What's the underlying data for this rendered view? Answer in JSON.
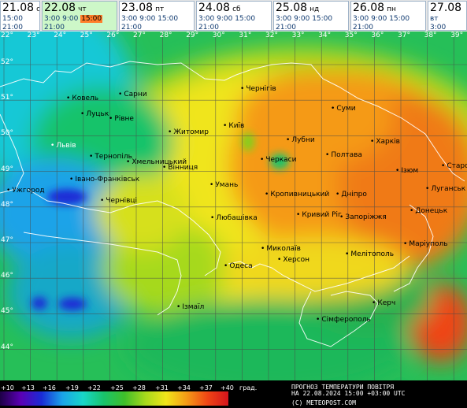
{
  "days": [
    {
      "date": "21.08",
      "dow": "ср",
      "hours": [
        "15:00"
      ],
      "hours2": "21:00",
      "active": false
    },
    {
      "date": "22.08",
      "dow": "чт",
      "hours": [
        "3:00",
        "9:00",
        "15:00"
      ],
      "hours2": "21:00",
      "active": true,
      "selected_hour": "15:00"
    },
    {
      "date": "23.08",
      "dow": "пт",
      "hours": [
        "3:00",
        "9:00",
        "15:00"
      ],
      "hours2": "21:00",
      "active": false
    },
    {
      "date": "24.08",
      "dow": "сб",
      "hours": [
        "3:00",
        "9:00",
        "15:00"
      ],
      "hours2": "21:00",
      "active": false
    },
    {
      "date": "25.08",
      "dow": "нд",
      "hours": [
        "3:00",
        "9:00",
        "15:00"
      ],
      "hours2": "21:00",
      "active": false
    },
    {
      "date": "26.08",
      "dow": "пн",
      "hours": [
        "3:00",
        "9:00",
        "15:00"
      ],
      "hours2": "21:00",
      "active": false
    },
    {
      "date": "27.08",
      "dow": "вт",
      "hours": [
        "3:00"
      ],
      "hours2": "",
      "active": false
    }
  ],
  "map": {
    "longitudes": [
      "22°",
      "23°",
      "24°",
      "25°",
      "26°",
      "27°",
      "28°",
      "29°",
      "30°",
      "31°",
      "32°",
      "33°",
      "34°",
      "35°",
      "36°",
      "37°",
      "38°",
      "39°"
    ],
    "latitudes": [
      "52°",
      "51°",
      "50°",
      "49°",
      "48°",
      "47°",
      "46°",
      "45°",
      "44°"
    ],
    "cities": [
      {
        "name": "Чернігів"
      },
      {
        "name": "Сарни"
      },
      {
        "name": "Ковель"
      },
      {
        "name": "Луцьк"
      },
      {
        "name": "Рівне"
      },
      {
        "name": "Суми"
      },
      {
        "name": "Житомир"
      },
      {
        "name": "Київ"
      },
      {
        "name": "Лубни"
      },
      {
        "name": "Харків"
      },
      {
        "name": "Львів"
      },
      {
        "name": "Тернопіль"
      },
      {
        "name": "Хмельницький"
      },
      {
        "name": "Полтава"
      },
      {
        "name": "Черкаси"
      },
      {
        "name": "Ізюм"
      },
      {
        "name": "Старобільськ"
      },
      {
        "name": "Вінниця"
      },
      {
        "name": "Івано-Франківськ"
      },
      {
        "name": "Луганськ"
      },
      {
        "name": "Ужгород"
      },
      {
        "name": "Умань"
      },
      {
        "name": "Кропивницький"
      },
      {
        "name": "Дніпро"
      },
      {
        "name": "Чернівці"
      },
      {
        "name": "Кривий Ріг"
      },
      {
        "name": "Запоріжжя"
      },
      {
        "name": "Донецьк"
      },
      {
        "name": "Любашівка"
      },
      {
        "name": "Маріуполь"
      },
      {
        "name": "Миколаїв"
      },
      {
        "name": "Херсон"
      },
      {
        "name": "Мелітополь"
      },
      {
        "name": "Одеса"
      },
      {
        "name": "Керч"
      },
      {
        "name": "Ізмаїл"
      },
      {
        "name": "Сімферополь"
      }
    ]
  },
  "legend": {
    "labels": [
      "+10",
      "+13",
      "+16",
      "+19",
      "+22",
      "+25",
      "+28",
      "+31",
      "+34",
      "+37",
      "+40"
    ],
    "unit": "град.",
    "colors": [
      "#1d0045",
      "#5b00b5",
      "#1a2bd6",
      "#1aa3e8",
      "#18d6c8",
      "#19c36b",
      "#3fbf2a",
      "#a6d91c",
      "#f0e51a",
      "#f59a16",
      "#ef4515",
      "#d3141c"
    ]
  },
  "footer": {
    "title_line1": "ПРОГНОЗ ТЕМПЕРАТУРИ ПОВІТРЯ",
    "title_line2": "НА 22.08.2024 15:00 +03:00 UTC",
    "copyright": "(C) METEOPOST.COM"
  }
}
